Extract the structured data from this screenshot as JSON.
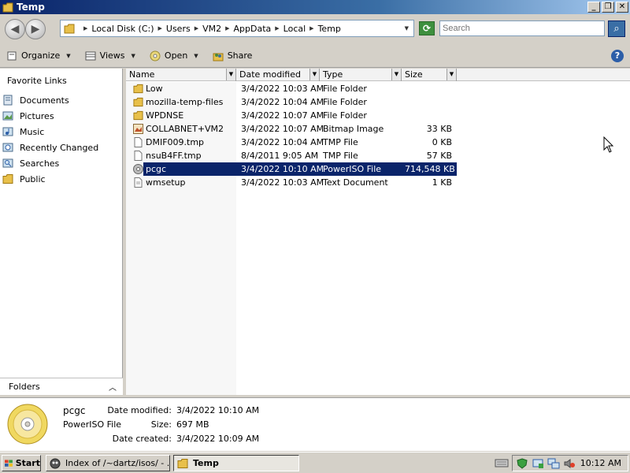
{
  "window": {
    "title": "Temp",
    "buttons": {
      "minimize": "_",
      "maximize": "❐",
      "close": "✕"
    }
  },
  "address": {
    "crumbs": [
      "Local Disk (C:)",
      "Users",
      "VM2",
      "AppData",
      "Local",
      "Temp"
    ],
    "search_placeholder": "Search"
  },
  "toolbar": {
    "organize": "Organize",
    "views": "Views",
    "open": "Open",
    "share": "Share",
    "help": "?"
  },
  "nav": {
    "heading": "Favorite Links",
    "items": [
      {
        "label": "Documents",
        "icon": "documents-icon"
      },
      {
        "label": "Pictures",
        "icon": "pictures-icon"
      },
      {
        "label": "Music",
        "icon": "music-icon"
      },
      {
        "label": "Recently Changed",
        "icon": "recently-changed-icon"
      },
      {
        "label": "Searches",
        "icon": "searches-icon"
      },
      {
        "label": "Public",
        "icon": "public-folder-icon"
      }
    ],
    "folders_label": "Folders"
  },
  "columns": [
    "Name",
    "Date modified",
    "Type",
    "Size"
  ],
  "files": [
    {
      "name": "Low",
      "date": "3/4/2022 10:03 AM",
      "type": "File Folder",
      "size": "",
      "icon": "folder"
    },
    {
      "name": "mozilla-temp-files",
      "date": "3/4/2022 10:04 AM",
      "type": "File Folder",
      "size": "",
      "icon": "folder"
    },
    {
      "name": "WPDNSE",
      "date": "3/4/2022 10:07 AM",
      "type": "File Folder",
      "size": "",
      "icon": "folder"
    },
    {
      "name": "COLLABNET+VM2",
      "date": "3/4/2022 10:07 AM",
      "type": "Bitmap Image",
      "size": "33 KB",
      "icon": "bitmap"
    },
    {
      "name": "DMIF009.tmp",
      "date": "3/4/2022 10:04 AM",
      "type": "TMP File",
      "size": "0 KB",
      "icon": "file"
    },
    {
      "name": "nsuB4FF.tmp",
      "date": "8/4/2011 9:05 AM",
      "type": "TMP File",
      "size": "57 KB",
      "icon": "file"
    },
    {
      "name": "pcgc",
      "date": "3/4/2022 10:10 AM",
      "type": "PowerISO File",
      "size": "714,548 KB",
      "icon": "disc",
      "selected": true
    },
    {
      "name": "wmsetup",
      "date": "3/4/2022 10:03 AM",
      "type": "Text Document",
      "size": "1 KB",
      "icon": "text"
    }
  ],
  "details": {
    "name": "pcgc",
    "type": "PowerISO File",
    "date_modified_label": "Date modified:",
    "date_modified": "3/4/2022 10:10 AM",
    "size_label": "Size:",
    "size": "697 MB",
    "date_created_label": "Date created:",
    "date_created": "3/4/2022 10:09 AM"
  },
  "taskbar": {
    "start": "Start",
    "tasks": [
      {
        "label": "Index of /~dartz/isos/ - ...",
        "active": false
      },
      {
        "label": "Temp",
        "active": true
      }
    ],
    "clock": "10:12 AM"
  }
}
